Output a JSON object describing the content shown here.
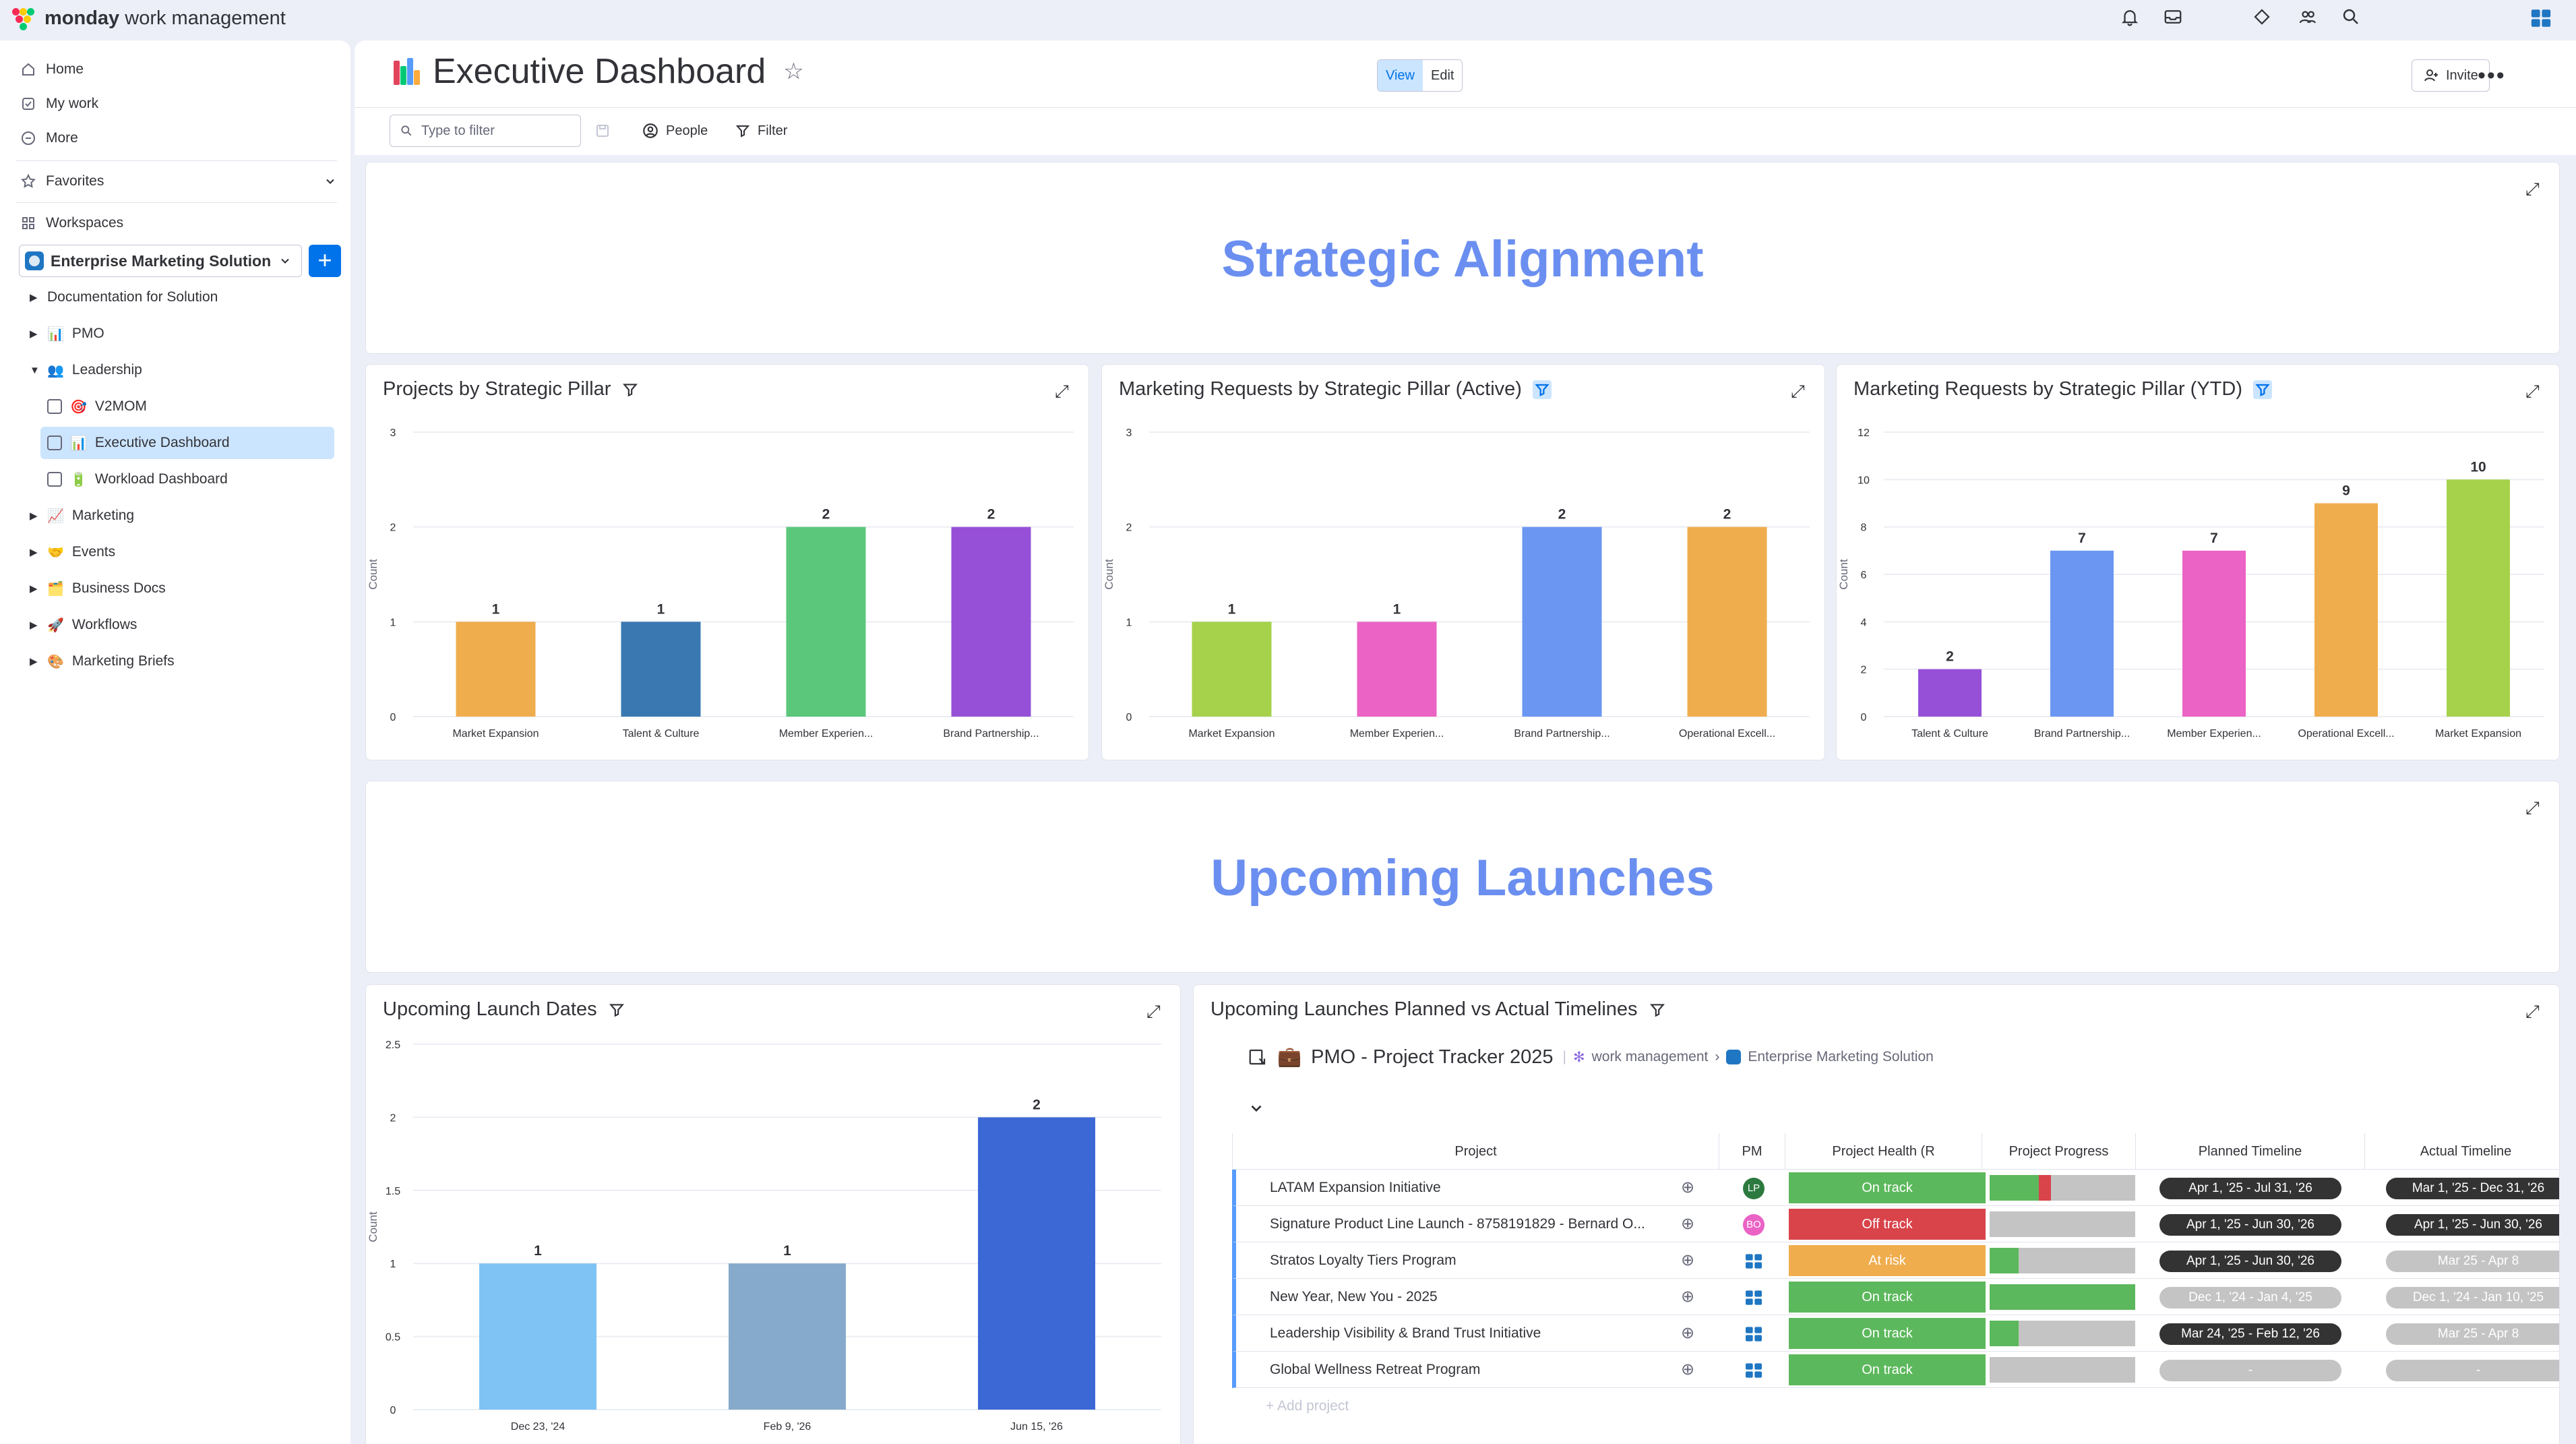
{
  "app": {
    "brand_bold": "monday",
    "brand_rest": "work management"
  },
  "topbar": {
    "icons": [
      "bell-icon",
      "inbox-icon",
      "apps-icon",
      "invite-members-icon",
      "search-icon",
      "apps-grid-icon"
    ]
  },
  "sidebar": {
    "primary": [
      {
        "label": "Home",
        "icon": "home-icon"
      },
      {
        "label": "My work",
        "icon": "checkbox-icon"
      },
      {
        "label": "More",
        "icon": "more-icon"
      }
    ],
    "favorites": "Favorites",
    "workspaces": "Workspaces",
    "workspace_name": "Enterprise Marketing Solution",
    "tree": [
      {
        "label": "Documentation for Solution",
        "emoji": "",
        "level": 0
      },
      {
        "label": "PMO",
        "emoji": "📊",
        "level": 0
      },
      {
        "label": "Leadership",
        "emoji": "👥",
        "level": 0,
        "open": true
      },
      {
        "label": "V2MOM",
        "emoji": "🎯",
        "level": 1
      },
      {
        "label": "Executive Dashboard",
        "emoji": "📊",
        "level": 1,
        "active": true
      },
      {
        "label": "Workload Dashboard",
        "emoji": "🔋",
        "level": 1
      },
      {
        "label": "Marketing",
        "emoji": "📈",
        "level": 0
      },
      {
        "label": "Events",
        "emoji": "🤝",
        "level": 0
      },
      {
        "label": "Business Docs",
        "emoji": "🗂️",
        "level": 0
      },
      {
        "label": "Workflows",
        "emoji": "🚀",
        "level": 0
      },
      {
        "label": "Marketing Briefs",
        "emoji": "🎨",
        "level": 0
      }
    ]
  },
  "header": {
    "title": "Executive Dashboard",
    "view_label": "View",
    "edit_label": "Edit",
    "invite_label": "Invite",
    "filter_placeholder": "Type to filter",
    "people_label": "People",
    "filter_label": "Filter"
  },
  "sections": {
    "strategic": "Strategic Alignment",
    "launches": "Upcoming Launches"
  },
  "chart_data": [
    {
      "type": "bar",
      "title": "Projects by Strategic Pillar",
      "ylabel": "Count",
      "ylim": [
        0,
        3
      ],
      "yticks": [
        0,
        1,
        2,
        3
      ],
      "categories": [
        "Market Expansion",
        "Talent & Culture",
        "Member Experien...",
        "Brand Partnership..."
      ],
      "values": [
        1,
        1,
        2,
        2
      ],
      "colors": [
        "#f0ad4e",
        "#3a78b1",
        "#5bc77b",
        "#9650d8"
      ]
    },
    {
      "type": "bar",
      "title": "Marketing Requests by Strategic Pillar (Active)",
      "ylabel": "Count",
      "ylim": [
        0,
        3
      ],
      "yticks": [
        0,
        1,
        2,
        3
      ],
      "categories": [
        "Market Expansion",
        "Member Experien...",
        "Brand Partnership...",
        "Operational Excell..."
      ],
      "values": [
        1,
        1,
        2,
        2
      ],
      "colors": [
        "#a6d24b",
        "#eb63c5",
        "#6b97f2",
        "#f0ad4e"
      ]
    },
    {
      "type": "bar",
      "title": "Marketing Requests by Strategic Pillar (YTD)",
      "ylabel": "Count",
      "ylim": [
        0,
        12
      ],
      "yticks": [
        0,
        2,
        4,
        6,
        8,
        10,
        12
      ],
      "categories": [
        "Talent & Culture",
        "Brand Partnership...",
        "Member Experien...",
        "Operational Excell...",
        "Market Expansion"
      ],
      "values": [
        2,
        7,
        7,
        9,
        10
      ],
      "colors": [
        "#9650d8",
        "#6b97f2",
        "#eb63c5",
        "#f0ad4e",
        "#a6d24b"
      ]
    },
    {
      "type": "bar",
      "title": "Upcoming Launch Dates",
      "ylabel": "Count",
      "ylim": [
        0,
        2.5
      ],
      "yticks": [
        0,
        0.5,
        1,
        1.5,
        2,
        2.5
      ],
      "categories": [
        "Dec 23, '24",
        "Feb 9, '26",
        "Jun 15, '26"
      ],
      "values": [
        1,
        1,
        2
      ],
      "colors": [
        "#7fc3f4",
        "#86aacb",
        "#3c68d6"
      ]
    }
  ],
  "table": {
    "panel_title": "Upcoming Launches Planned vs Actual Timelines",
    "board_name": "PMO - Project Tracker 2025",
    "crumb_product": "work management",
    "crumb_workspace": "Enterprise Marketing Solution",
    "columns": [
      "Project",
      "PM",
      "Project Health (R",
      "Project Progress",
      "Planned Timeline",
      "Actual Timeline"
    ],
    "add_label": "+ Add project",
    "rows": [
      {
        "name": "LATAM Expansion Initiative",
        "pm": "LP",
        "pm_color": "#2c7a3f",
        "health": "On track",
        "health_color": "#5cb85c",
        "progress_green": 0.34,
        "progress_red": 0.08,
        "planned": "Apr 1, '25 - Jul 31, '26",
        "planned_dark": true,
        "actual": "Mar 1, '25 - Dec 31, '26",
        "actual_dark": true
      },
      {
        "name": "Signature Product Line Launch - 8758191829 - Bernard O...",
        "pm": "BO",
        "pm_color": "#eb63c5",
        "health": "Off track",
        "health_color": "#d9434a",
        "progress_green": 0,
        "progress_red": 0,
        "planned": "Apr 1, '25 - Jun 30, '26",
        "planned_dark": true,
        "actual": "Apr 1, '25 - Jun 30, '26",
        "actual_dark": true
      },
      {
        "name": "Stratos Loyalty Tiers Program",
        "pm": "",
        "pm_color": "",
        "health": "At risk",
        "health_color": "#f0ad4e",
        "progress_green": 0.2,
        "progress_red": 0,
        "planned": "Apr 1, '25 - Jun 30, '26",
        "planned_dark": true,
        "actual": "Mar 25 - Apr 8",
        "actual_dark": false
      },
      {
        "name": "New Year, New You - 2025",
        "pm": "",
        "pm_color": "",
        "health": "On track",
        "health_color": "#5cb85c",
        "progress_green": 1.0,
        "progress_red": 0,
        "planned": "Dec 1, '24 - Jan 4, '25",
        "planned_dark": false,
        "actual": "Dec 1, '24 - Jan 10, '25",
        "actual_dark": false
      },
      {
        "name": "Leadership Visibility & Brand Trust Initiative",
        "pm": "",
        "pm_color": "",
        "health": "On track",
        "health_color": "#5cb85c",
        "progress_green": 0.2,
        "progress_red": 0,
        "planned": "Mar 24, '25 - Feb 12, '26",
        "planned_dark": true,
        "actual": "Mar 25 - Apr 8",
        "actual_dark": false
      },
      {
        "name": "Global Wellness Retreat Program",
        "pm": "",
        "pm_color": "",
        "health": "On track",
        "health_color": "#5cb85c",
        "progress_green": 0,
        "progress_red": 0,
        "planned": "-",
        "planned_dark": false,
        "actual": "-",
        "actual_dark": false
      }
    ]
  }
}
